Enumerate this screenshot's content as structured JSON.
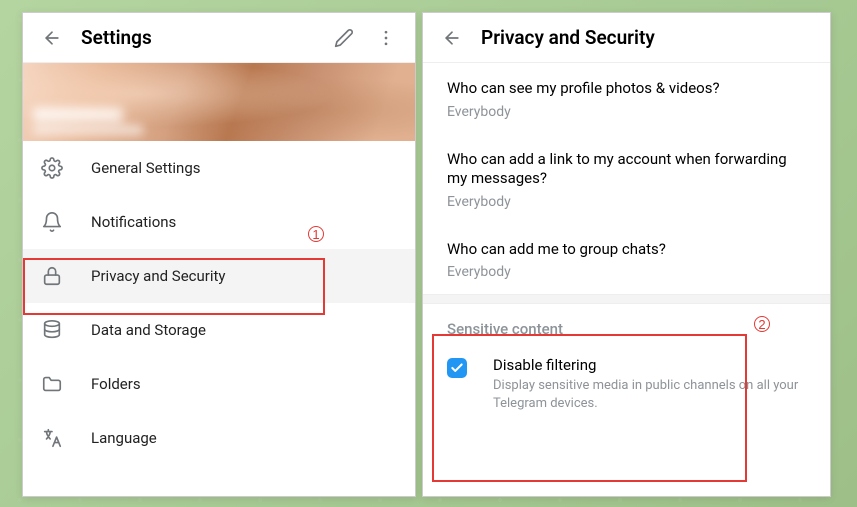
{
  "settings_panel": {
    "title": "Settings",
    "menu": [
      {
        "icon": "gear",
        "label": "General Settings"
      },
      {
        "icon": "bell",
        "label": "Notifications"
      },
      {
        "icon": "lock",
        "label": "Privacy and Security"
      },
      {
        "icon": "database",
        "label": "Data and Storage"
      },
      {
        "icon": "folder",
        "label": "Folders"
      },
      {
        "icon": "language",
        "label": "Language"
      }
    ]
  },
  "privacy_panel": {
    "title": "Privacy and Security",
    "items": [
      {
        "q": "Who can see my profile photos & videos?",
        "a": "Everybody"
      },
      {
        "q": "Who can add a link to my account when forwarding my messages?",
        "a": "Everybody"
      },
      {
        "q": "Who can add me to group chats?",
        "a": "Everybody"
      }
    ],
    "section_header": "Sensitive content",
    "check": {
      "title": "Disable filtering",
      "desc": "Display sensitive media in public channels on all your Telegram devices.",
      "checked": true
    }
  },
  "callouts": {
    "one": "1",
    "two": "2"
  }
}
